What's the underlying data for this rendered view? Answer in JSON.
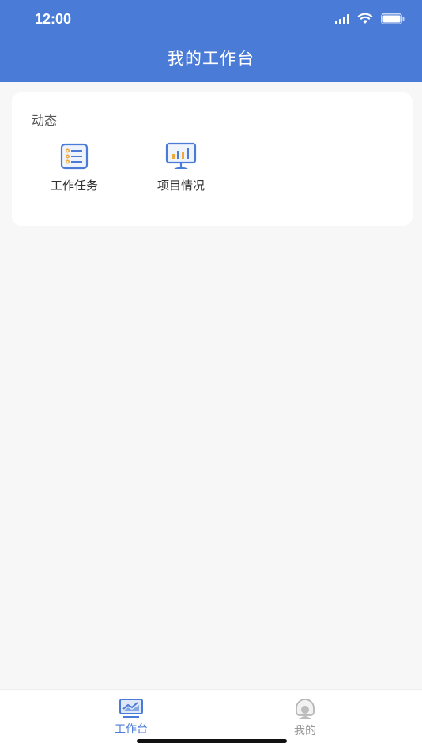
{
  "status_bar": {
    "time": "12:00"
  },
  "header": {
    "title": "我的工作台"
  },
  "section": {
    "title": "动态",
    "items": [
      {
        "label": "工作任务",
        "icon": "task-list-icon"
      },
      {
        "label": "项目情况",
        "icon": "chart-monitor-icon"
      }
    ]
  },
  "tabbar": {
    "tabs": [
      {
        "label": "工作台",
        "icon": "workbench-icon",
        "active": true
      },
      {
        "label": "我的",
        "icon": "profile-icon",
        "active": false
      }
    ]
  },
  "colors": {
    "primary": "#4a7bd6",
    "background": "#f7f7f8",
    "inactive": "#9a9a9a"
  }
}
